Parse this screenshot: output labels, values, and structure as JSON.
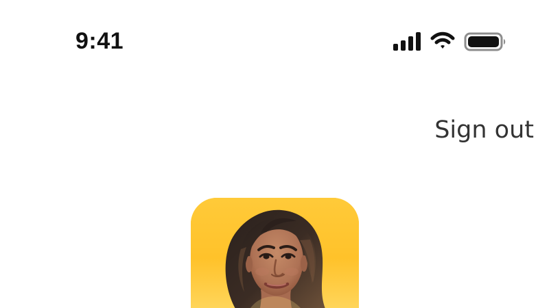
{
  "status_bar": {
    "time": "9:41",
    "icons": [
      "signal-icon",
      "wifi-icon",
      "battery-icon"
    ]
  },
  "header": {
    "sign_out_label": "Sign out"
  },
  "profile": {
    "avatar_icon": "avatar",
    "background_color": "#ffc935"
  },
  "colors": {
    "text_primary": "#111111",
    "text_secondary": "#333333",
    "accent": "#ffc935"
  }
}
